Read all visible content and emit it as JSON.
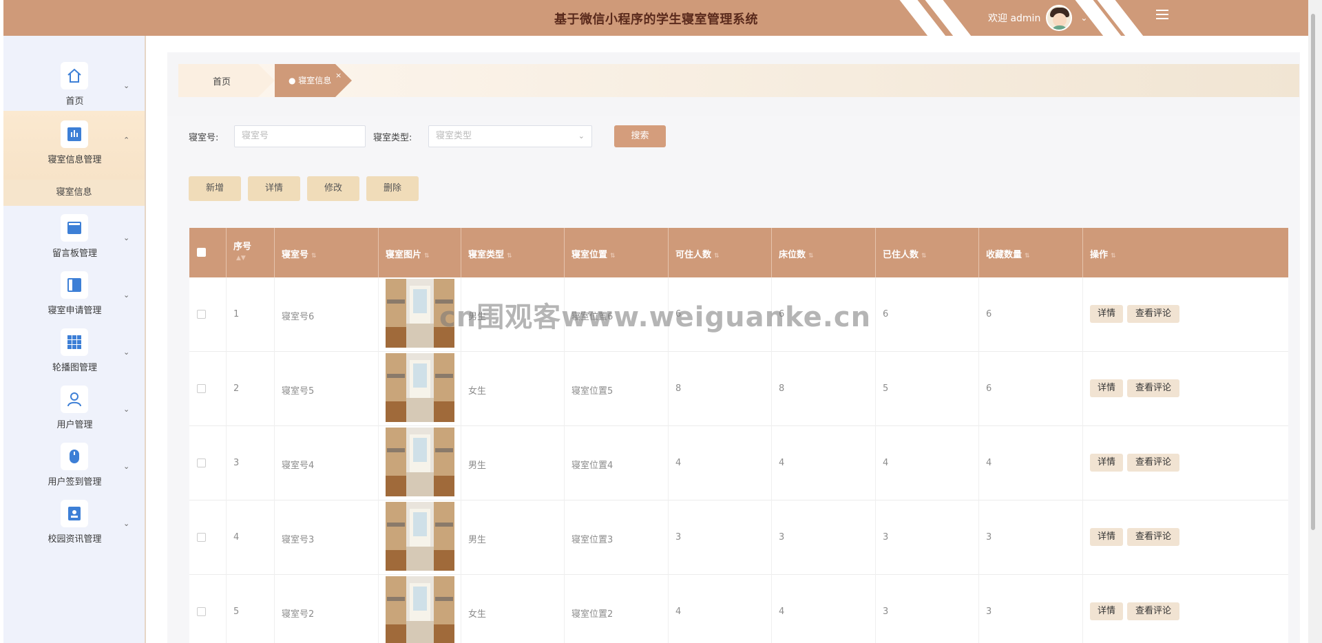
{
  "header": {
    "title": "基于微信小程序的学生寝室管理系统",
    "welcome": "欢迎 admin",
    "color": "#cf9a79"
  },
  "sidebar": {
    "items": [
      {
        "label": "首页",
        "icon": "home-icon",
        "expanded": false
      },
      {
        "label": "寝室信息管理",
        "icon": "chart-bars-icon",
        "expanded": true,
        "sub": "寝室信息"
      },
      {
        "label": "留言板管理",
        "icon": "board-icon",
        "expanded": false
      },
      {
        "label": "寝室申请管理",
        "icon": "book-icon",
        "expanded": false
      },
      {
        "label": "轮播图管理",
        "icon": "grid-icon",
        "expanded": false
      },
      {
        "label": "用户管理",
        "icon": "user-icon",
        "expanded": false
      },
      {
        "label": "用户签到管理",
        "icon": "mouse-icon",
        "expanded": false
      },
      {
        "label": "校园资讯管理",
        "icon": "id-card-icon",
        "expanded": false
      }
    ]
  },
  "breadcrumb": {
    "home": "首页",
    "current": "寝室信息",
    "close": "×"
  },
  "search": {
    "room_label": "寝室号:",
    "room_placeholder": "寝室号",
    "type_label": "寝室类型:",
    "type_placeholder": "寝室类型",
    "button": "搜索"
  },
  "actions": {
    "add": "新增",
    "detail": "详情",
    "edit": "修改",
    "delete": "删除"
  },
  "table": {
    "headers": [
      "序号",
      "寝室号",
      "寝室图片",
      "寝室类型",
      "寝室位置",
      "可住人数",
      "床位数",
      "已住人数",
      "收藏数量",
      "操作"
    ],
    "rows": [
      {
        "index": "1",
        "room": "寝室号6",
        "type": "男生",
        "location": "寝室位置6",
        "capacity": "6",
        "beds": "6",
        "occupied": "6",
        "favorites": "6"
      },
      {
        "index": "2",
        "room": "寝室号5",
        "type": "女生",
        "location": "寝室位置5",
        "capacity": "8",
        "beds": "8",
        "occupied": "5",
        "favorites": "6"
      },
      {
        "index": "3",
        "room": "寝室号4",
        "type": "男生",
        "location": "寝室位置4",
        "capacity": "4",
        "beds": "4",
        "occupied": "4",
        "favorites": "4"
      },
      {
        "index": "4",
        "room": "寝室号3",
        "type": "男生",
        "location": "寝室位置3",
        "capacity": "3",
        "beds": "3",
        "occupied": "3",
        "favorites": "3"
      },
      {
        "index": "5",
        "room": "寝室号2",
        "type": "女生",
        "location": "寝室位置2",
        "capacity": "4",
        "beds": "4",
        "occupied": "3",
        "favorites": "3"
      }
    ],
    "op_detail": "详情",
    "op_comments": "查看评论"
  },
  "watermark": "cn围观客www.weiguanke.cn"
}
